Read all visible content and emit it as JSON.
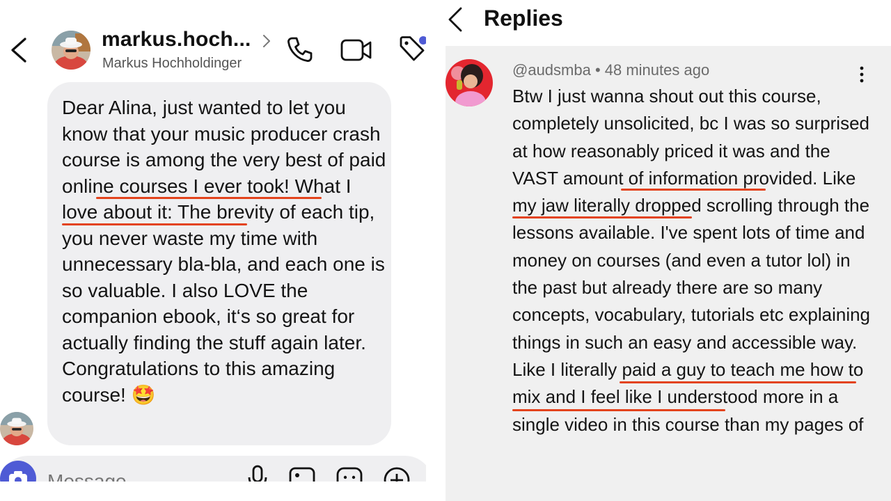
{
  "dm": {
    "username": "markus.hoch...",
    "display_name": "Markus Hochholdinger",
    "message": "Dear Alina, just wanted to let you know that your music producer crash course is among the very best of paid online courses I ever took! What I love about it: The brevity of each tip, you never waste my time with unnecessary bla-bla, and each one is so valuable. I also LOVE the companion ebook, it‘s so great for actually finding the stuff again later. Congratulations to this amazing course! 🤩",
    "composer_placeholder": "Message",
    "icons": [
      "back-arrow-icon",
      "call-icon",
      "video-call-icon",
      "tag-icon",
      "camera-icon",
      "microphone-icon",
      "gallery-icon",
      "sticker-icon",
      "plus-icon"
    ],
    "accent_color": "#e3431c"
  },
  "replies": {
    "title": "Replies",
    "comment": {
      "meta": "@audsmba • 48 minutes ago",
      "text": "Btw I just wanna shout out this course, completely unsolicited, bc I was so surprised at how reasonably priced it was and the VAST amount of information provided. Like my jaw literally dropped scrolling through the lessons available. I've spent lots of time and money on courses (and even a tutor lol) in the past but already there are so many concepts, vocabulary, tutorials etc explaining things in such an easy and accessible way. Like I literally paid a guy to teach me how to mix and I feel like I understood more in a single video in this course than my pages of"
    }
  }
}
